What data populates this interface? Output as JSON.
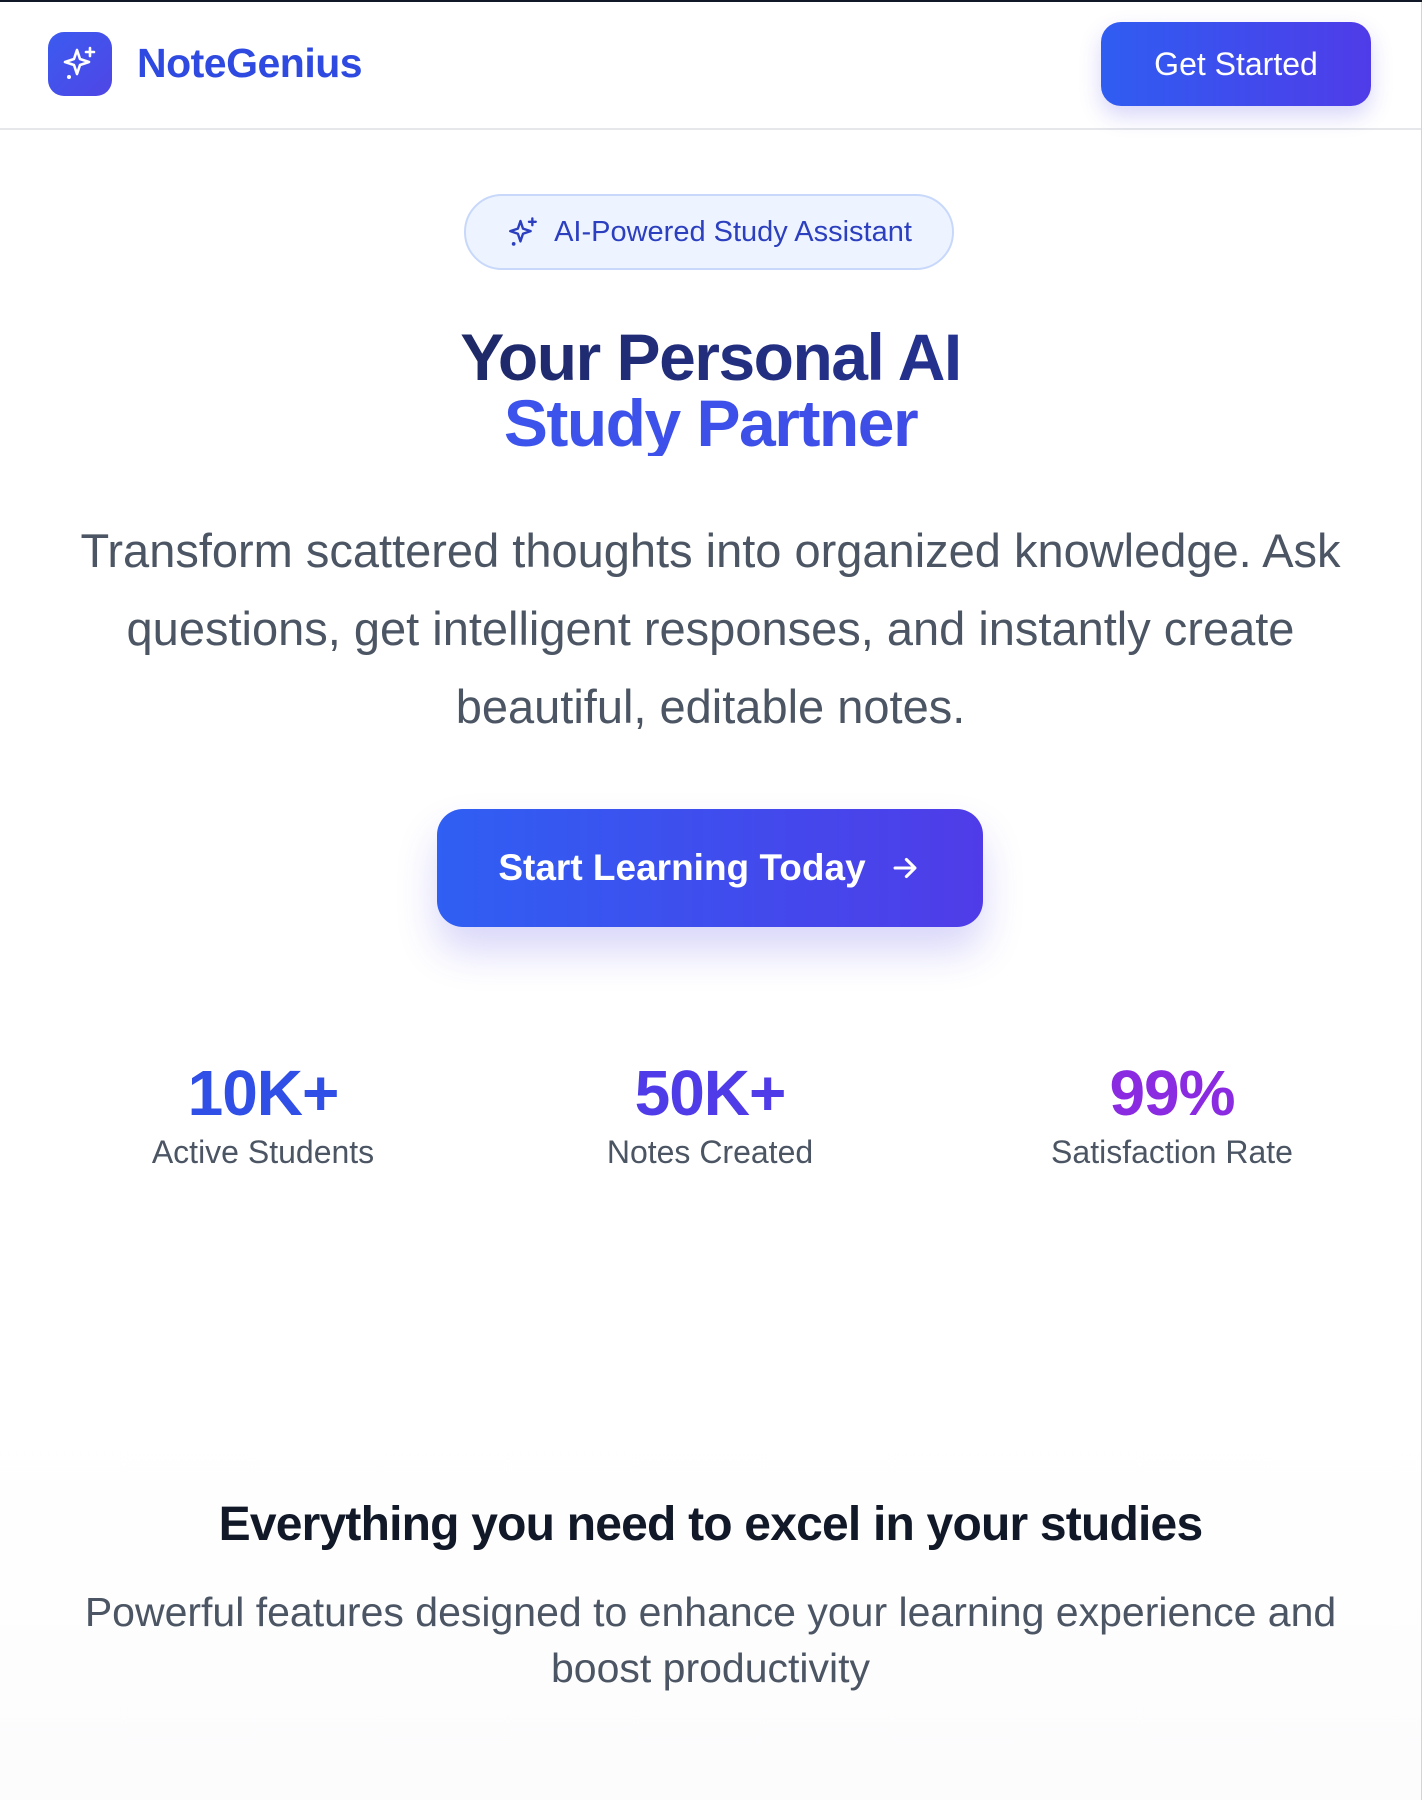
{
  "header": {
    "brand": "NoteGenius",
    "get_started_label": "Get Started"
  },
  "hero": {
    "badge_text": "AI-Powered Study Assistant",
    "title_line1": "Your Personal AI",
    "title_line2": "Study Partner",
    "description": "Transform scattered thoughts into organized knowledge. Ask questions, get intelligent responses, and instantly create beautiful, editable notes.",
    "cta_label": "Start Learning Today"
  },
  "stats": [
    {
      "value": "10K+",
      "label": "Active Students",
      "color": "#2f4fe6"
    },
    {
      "value": "50K+",
      "label": "Notes Created",
      "color": "#4f3ce8"
    },
    {
      "value": "99%",
      "label": "Satisfaction Rate",
      "color": "#8a2be2"
    }
  ],
  "features": {
    "title": "Everything you need to excel in your studies",
    "description": "Powerful features designed to enhance your learning experience and boost productivity"
  },
  "icons": {
    "logo": "sparkles-icon",
    "badge": "sparkles-icon",
    "cta": "arrow-right-icon"
  },
  "colors": {
    "brand": "#2f4ae0",
    "accent_start": "#2f5df2",
    "accent_end": "#4f3ce8",
    "badge_bg": "#eef4ff",
    "badge_border": "#c7d8fb"
  }
}
